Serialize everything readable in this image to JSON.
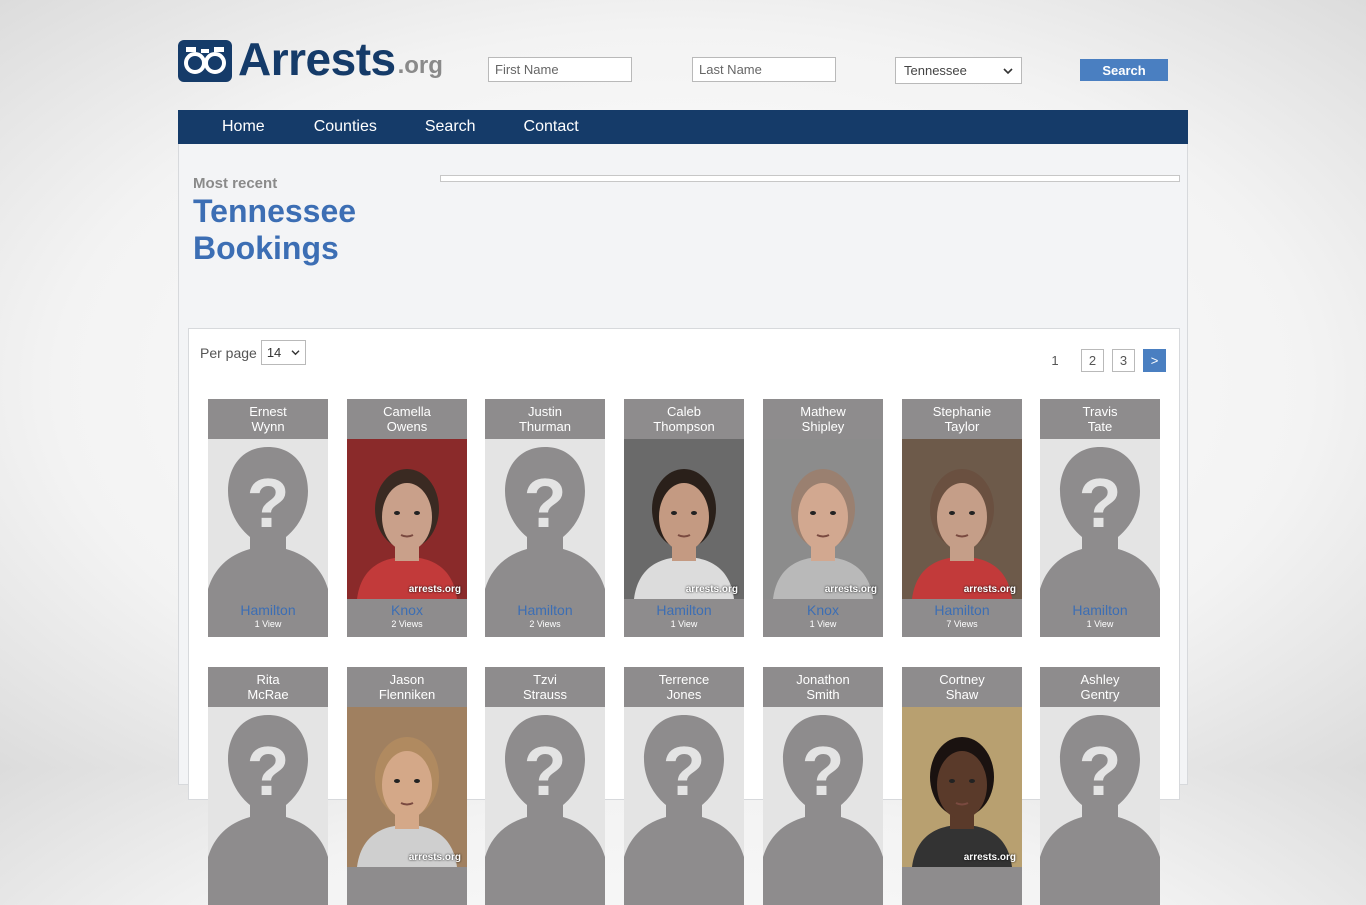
{
  "header": {
    "logo_text": "Arrests",
    "logo_tld": ".org",
    "first_name_placeholder": "First Name",
    "last_name_placeholder": "Last Name",
    "state_selected": "Tennessee",
    "search_label": "Search"
  },
  "nav": {
    "items": [
      "Home",
      "Counties",
      "Search",
      "Contact"
    ]
  },
  "main": {
    "kicker": "Most recent",
    "title_line1": "Tennessee",
    "title_line2": "Bookings",
    "per_page_label": "Per page",
    "per_page_value": "14",
    "pagination": {
      "current": "1",
      "pages": [
        "2",
        "3"
      ],
      "next": ">"
    }
  },
  "bookings": [
    {
      "first": "Ernest",
      "last": "Wynn",
      "county": "Hamilton",
      "views": "1 View",
      "photo": "placeholder"
    },
    {
      "first": "Camella",
      "last": "Owens",
      "county": "Knox",
      "views": "2 Views",
      "photo": "mugshot"
    },
    {
      "first": "Justin",
      "last": "Thurman",
      "county": "Hamilton",
      "views": "2 Views",
      "photo": "placeholder"
    },
    {
      "first": "Caleb",
      "last": "Thompson",
      "county": "Hamilton",
      "views": "1 View",
      "photo": "mugshot"
    },
    {
      "first": "Mathew",
      "last": "Shipley",
      "county": "Knox",
      "views": "1 View",
      "photo": "mugshot"
    },
    {
      "first": "Stephanie",
      "last": "Taylor",
      "county": "Hamilton",
      "views": "7 Views",
      "photo": "mugshot"
    },
    {
      "first": "Travis",
      "last": "Tate",
      "county": "Hamilton",
      "views": "1 View",
      "photo": "placeholder"
    },
    {
      "first": "Rita",
      "last": "McRae",
      "county": "",
      "views": "",
      "photo": "placeholder"
    },
    {
      "first": "Jason",
      "last": "Flenniken",
      "county": "",
      "views": "",
      "photo": "mugshot"
    },
    {
      "first": "Tzvi",
      "last": "Strauss",
      "county": "",
      "views": "",
      "photo": "placeholder"
    },
    {
      "first": "Terrence",
      "last": "Jones",
      "county": "",
      "views": "",
      "photo": "placeholder"
    },
    {
      "first": "Jonathon",
      "last": "Smith",
      "county": "",
      "views": "",
      "photo": "placeholder"
    },
    {
      "first": "Cortney",
      "last": "Shaw",
      "county": "",
      "views": "",
      "photo": "mugshot"
    },
    {
      "first": "Ashley",
      "last": "Gentry",
      "county": "",
      "views": "",
      "photo": "placeholder"
    }
  ],
  "photo_watermark": "arrests.org",
  "colors": {
    "brand": "#153b69",
    "accent": "#4a7fc1",
    "link": "#3c6eb4",
    "card": "#8e8c8d"
  }
}
